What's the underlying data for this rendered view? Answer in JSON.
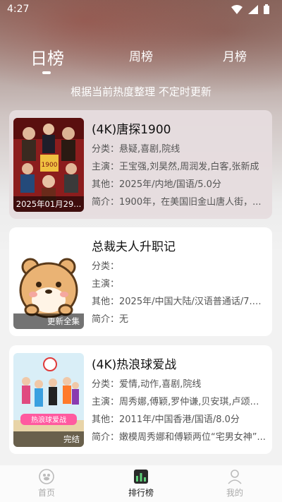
{
  "status": {
    "time": "4:27"
  },
  "tabs": [
    {
      "label": "日榜",
      "active": true
    },
    {
      "label": "周榜",
      "active": false
    },
    {
      "label": "月榜",
      "active": false
    }
  ],
  "subtitle": "根据当前热度整理 不定时更新",
  "cards": [
    {
      "title": "(4K)唐探1900",
      "poster_caption": "2025年01月29...",
      "category": "分类：悬疑,喜剧,院线",
      "cast": "主演：王宝强,刘昊然,周润发,白客,张新成",
      "other": "其他：2025年/内地/国语/5.0分",
      "intro": "简介：1900年，在美国旧金山唐人街，..."
    },
    {
      "title": "总裁夫人升职记",
      "poster_caption": "更新全集",
      "category": "分类：",
      "cast": "主演：",
      "other": "其他：2025年/中国大陆/汉语普通话/7.0...",
      "intro": "简介：无"
    },
    {
      "title": "(4K)热浪球爱战",
      "poster_caption": "完结",
      "category": "分类：爱情,动作,喜剧,院线",
      "cast": "主演：周秀娜,傅颖,罗仲谦,贝安琪,卢颂之,...",
      "other": "其他：2011年/中国香港/国语/8.0分",
      "intro": "简介：嫩模周秀娜和傅颖两位“宅男女神”..."
    }
  ],
  "nav": [
    {
      "label": "首页",
      "icon": "home-icon",
      "active": false
    },
    {
      "label": "排行榜",
      "icon": "ranking-icon",
      "active": true
    },
    {
      "label": "我的",
      "icon": "profile-icon",
      "active": false
    }
  ],
  "colors": {
    "accent": "#1e7a3c",
    "text": "#111111",
    "muted": "#555555"
  }
}
